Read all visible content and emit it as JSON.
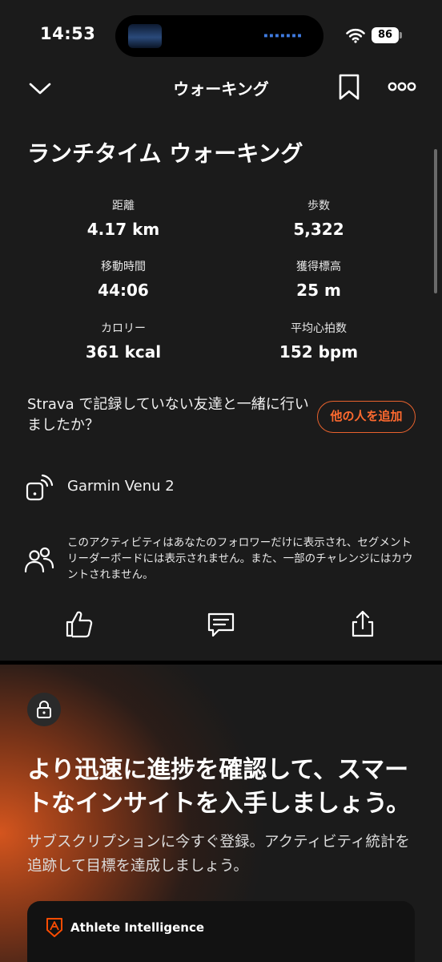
{
  "status_bar": {
    "time": "14:53",
    "battery": "86"
  },
  "nav": {
    "title": "ウォーキング"
  },
  "activity": {
    "title": "ランチタイム ウォーキング",
    "stats": [
      {
        "label": "距離",
        "value": "4.17 km"
      },
      {
        "label": "歩数",
        "value": "5,322"
      },
      {
        "label": "移動時間",
        "value": "44:06"
      },
      {
        "label": "獲得標高",
        "value": "25 m"
      },
      {
        "label": "カロリー",
        "value": "361 kcal"
      },
      {
        "label": "平均心拍数",
        "value": "152 bpm"
      }
    ]
  },
  "companions": {
    "text": "Strava で記録していない友達と一緒に行いましたか？",
    "button": "他の人を追加"
  },
  "device": {
    "name": "Garmin Venu 2"
  },
  "privacy": {
    "text": "このアクティビティはあなたのフォロワーだけに表示され、セグメントリーダーボードには表示されません。また、一部のチャレンジにはカウントされません。"
  },
  "icons": {
    "back": "chevron-down-icon",
    "bookmark": "bookmark-icon",
    "more": "more-icon",
    "device": "device-sync-icon",
    "privacy": "followers-icon",
    "kudos": "thumbs-up-icon",
    "comment": "comment-icon",
    "share": "share-icon",
    "lock": "lock-icon"
  },
  "promo": {
    "title": "より迅速に進捗を確認して、スマートなインサイトを入手しましょう。",
    "description": "サブスクリプションに今すぐ登録。アクティビティ統計を追跡して目標を達成しましょう。",
    "card_label": "Athlete Intelligence"
  },
  "colors": {
    "accent": "#ff6a2f",
    "background": "#1b1b1b"
  }
}
